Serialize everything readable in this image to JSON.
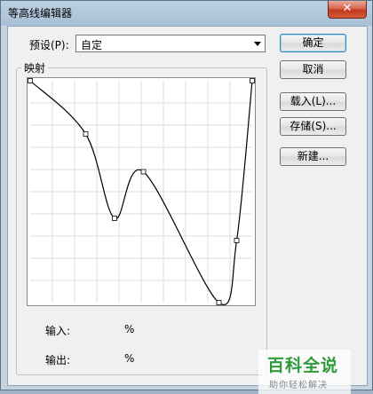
{
  "window": {
    "title": "等高线编辑器",
    "close_glyph": "✕"
  },
  "preset": {
    "label": "预设(P):",
    "value": "自定"
  },
  "mapping": {
    "legend": "映射"
  },
  "io": {
    "input_label": "输入:",
    "input_unit": "%",
    "output_label": "输出:",
    "output_unit": "%"
  },
  "buttons": {
    "ok": "确定",
    "cancel": "取消",
    "load": "载入(L)...",
    "save": "存储(S)...",
    "new": "新建..."
  },
  "curve": {
    "grid_divisions": 10,
    "points": [
      [
        0,
        100
      ],
      [
        25,
        76
      ],
      [
        38,
        38
      ],
      [
        51,
        59
      ],
      [
        85,
        0
      ],
      [
        93,
        28
      ],
      [
        100,
        100
      ]
    ]
  },
  "watermark": {
    "main": "百科全说",
    "sub": "助你轻松解决",
    "color": "#2f9a3a"
  }
}
